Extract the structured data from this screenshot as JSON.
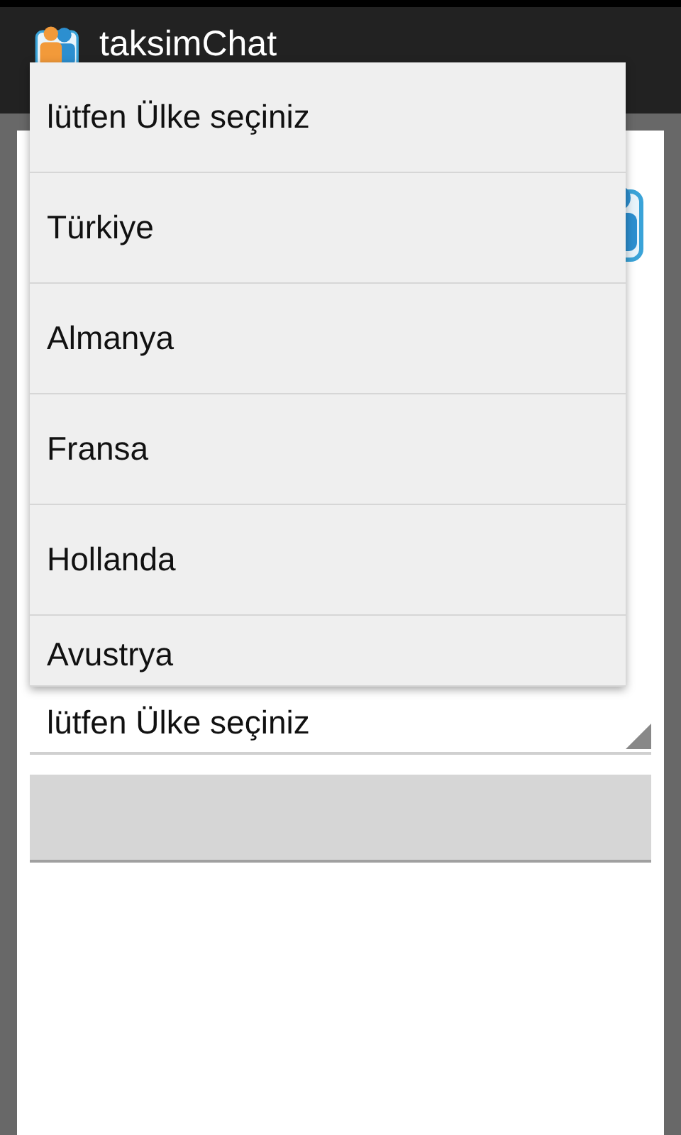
{
  "app_bar": {
    "title": "taksimChat"
  },
  "country_spinner": {
    "value": "lütfen Ülke seçiniz"
  },
  "dropdown": {
    "items": [
      {
        "label": "lütfen Ülke seçiniz"
      },
      {
        "label": "Türkiye"
      },
      {
        "label": "Almanya"
      },
      {
        "label": "Fransa"
      },
      {
        "label": "Hollanda"
      },
      {
        "label": "Avustrya"
      }
    ]
  }
}
